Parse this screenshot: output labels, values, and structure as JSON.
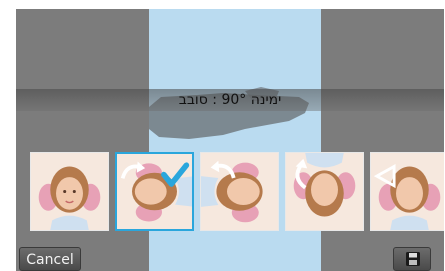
{
  "editor": {
    "rotate_label": "ימינה 90° : סובב"
  },
  "toolbar": {
    "cancel_label": "Cancel",
    "save_icon": "save-icon"
  },
  "thumbnails": [
    {
      "name": "original",
      "icon": "",
      "selected": false
    },
    {
      "name": "rotate-right",
      "icon": "rotate-right-arrow-icon",
      "selected": true
    },
    {
      "name": "rotate-left",
      "icon": "rotate-left-arrow-icon",
      "selected": false
    },
    {
      "name": "rotate-180",
      "icon": "rotate-180-arrow-icon",
      "selected": false
    },
    {
      "name": "flip-horizontal",
      "icon": "flip-horizontal-icon",
      "selected": false
    }
  ],
  "colors": {
    "accent": "#2aa6dc",
    "preview_background": "#badbf0",
    "background": "#7c7c7c"
  }
}
